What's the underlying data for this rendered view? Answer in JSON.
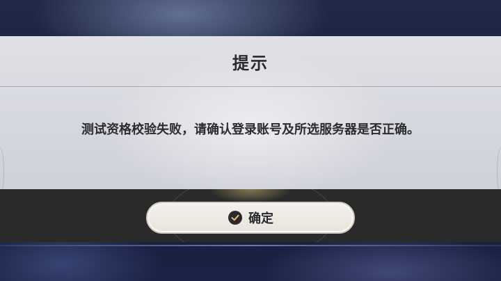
{
  "dialog": {
    "title": "提示",
    "message": "测试资格校验失败，请确认登录账号及所选服务器是否正确。"
  },
  "footer": {
    "confirm_label": "确定",
    "confirm_icon": "check-circle-icon"
  },
  "colors": {
    "panel": "#d8dae0",
    "footer": "#2a2a2b",
    "button": "#eeebe5",
    "text": "#2a2a2e"
  }
}
